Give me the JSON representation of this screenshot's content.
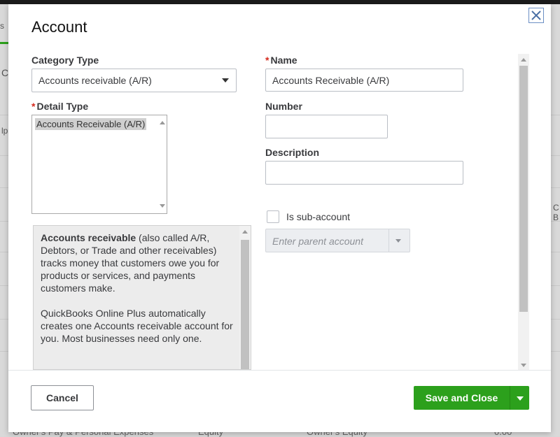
{
  "background": {
    "tab_fragment": "s",
    "edge_letters": [
      "C",
      "lp",
      "C B"
    ],
    "footer_row": [
      "Owner's Pay & Personal Expenses",
      "Equity",
      "Owner's Equity",
      "0.00"
    ]
  },
  "modal": {
    "title": "Account",
    "close_icon": "close-icon"
  },
  "left": {
    "category_type_label": "Category Type",
    "category_type_value": "Accounts receivable (A/R)",
    "detail_type_label": "Detail Type",
    "detail_type_options": [
      "Accounts Receivable (A/R)"
    ],
    "description_bold": "Accounts receivable",
    "description_rest": " (also called A/R, Debtors, or Trade and other receivables) tracks money that customers owe you for products or services, and payments customers make.",
    "description_para2": "QuickBooks Online Plus automatically creates one Accounts receivable account for you. Most businesses need only one."
  },
  "right": {
    "name_label": "Name",
    "name_value": "Accounts Receivable (A/R)",
    "number_label": "Number",
    "number_value": "",
    "description_label": "Description",
    "description_value": "",
    "subaccount_label": "Is sub-account",
    "parent_placeholder": "Enter parent account"
  },
  "footer": {
    "cancel_label": "Cancel",
    "save_label": "Save and Close"
  },
  "colors": {
    "accent_green": "#2ca01c",
    "required_red": "#d52b1e"
  }
}
